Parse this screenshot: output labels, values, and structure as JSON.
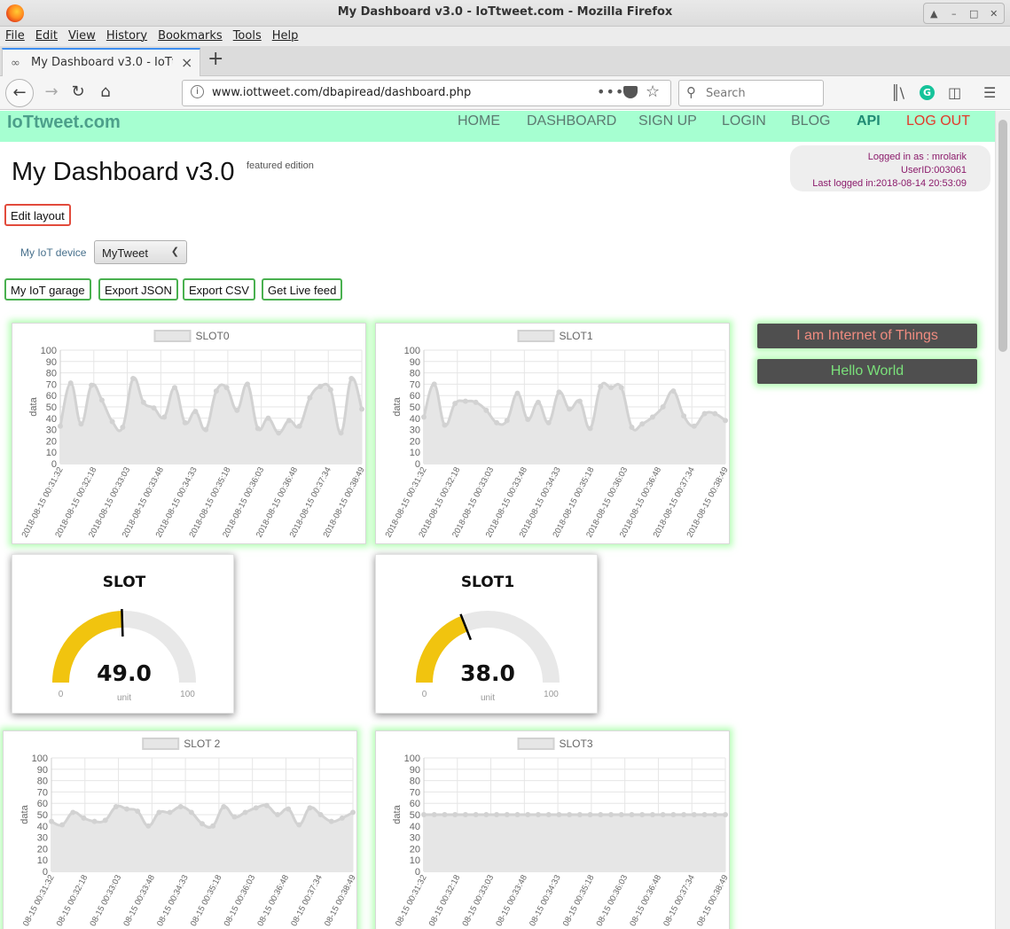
{
  "window": {
    "title": "My Dashboard v3.0 - IoTtweet.com - Mozilla Firefox"
  },
  "menu": [
    "File",
    "Edit",
    "View",
    "History",
    "Bookmarks",
    "Tools",
    "Help"
  ],
  "tab": {
    "label": "My Dashboard v3.0 - IoTtweet.com"
  },
  "url": "www.iottweet.com/dbapiread/dashboard.php",
  "search_placeholder": "Search",
  "site": {
    "brand": "IoTtweet.com",
    "nav": [
      "HOME",
      "DASHBOARD",
      "SIGN UP",
      "LOGIN",
      "BLOG",
      "API",
      "LOG OUT"
    ]
  },
  "page": {
    "title": "My Dashboard v3.0",
    "subtitle": "featured edition"
  },
  "user": {
    "logged_in_as": "Logged in as : mrolarik",
    "user_id": "UserID:003061",
    "last_login": "Last logged in:2018-08-14 20:53:09"
  },
  "buttons": {
    "edit_layout": "Edit layout",
    "garage": "My IoT garage",
    "export_json": "Export JSON",
    "export_csv": "Export CSV",
    "live_feed": "Get Live feed"
  },
  "device": {
    "label": "My IoT device",
    "selected": "MyTweet"
  },
  "messages": [
    {
      "text": "I am Internet of Things",
      "color": "#f08c80"
    },
    {
      "text": "Hello World",
      "color": "#7ae07a"
    }
  ],
  "colors": {
    "series_line": "#d2d2d2",
    "series_fill": "#e6e6e6",
    "gauge_fill": "#f1c40f",
    "gauge_track": "#e8e8e8"
  },
  "chart_data": [
    {
      "type": "line",
      "legend": "SLOT0",
      "ylabel": "data",
      "ylim": [
        0,
        100
      ],
      "yticks": [
        100,
        90,
        80,
        70,
        60,
        50,
        40,
        30,
        20,
        10,
        0
      ],
      "x": [
        "2018-08-15 00:31:32",
        "2018-08-15 00:32:18",
        "2018-08-15 00:33:03",
        "2018-08-15 00:33:48",
        "2018-08-15 00:34:33",
        "2018-08-15 00:35:18",
        "2018-08-15 00:36:03",
        "2018-08-15 00:36:48",
        "2018-08-15 00:37:34",
        "2018-08-15 00:38:49"
      ],
      "values": [
        33,
        71,
        35,
        69,
        56,
        37,
        32,
        75,
        54,
        49,
        41,
        67,
        36,
        46,
        30,
        64,
        67,
        47,
        70,
        31,
        40,
        27,
        38,
        33,
        58,
        68,
        65,
        27,
        75,
        48
      ]
    },
    {
      "type": "line",
      "legend": "SLOT1",
      "ylabel": "data",
      "ylim": [
        0,
        100
      ],
      "yticks": [
        100,
        90,
        80,
        70,
        60,
        50,
        40,
        30,
        20,
        10,
        0
      ],
      "x": [
        "2018-08-15 00:31:32",
        "2018-08-15 00:32:18",
        "2018-08-15 00:33:03",
        "2018-08-15 00:33:48",
        "2018-08-15 00:34:33",
        "2018-08-15 00:35:18",
        "2018-08-15 00:36:03",
        "2018-08-15 00:36:48",
        "2018-08-15 00:37:34",
        "2018-08-15 00:38:49"
      ],
      "values": [
        41,
        70,
        34,
        53,
        55,
        54,
        47,
        36,
        38,
        62,
        39,
        54,
        36,
        63,
        48,
        55,
        31,
        68,
        67,
        67,
        32,
        35,
        41,
        50,
        64,
        42,
        33,
        44,
        44,
        38
      ]
    },
    {
      "type": "gauge",
      "title": "SLOT",
      "value": 49.0,
      "value_label": "49.0",
      "min": 0,
      "max": 100,
      "min_label": "0",
      "max_label": "100",
      "unit": "unit"
    },
    {
      "type": "gauge",
      "title": "SLOT1",
      "value": 38.0,
      "value_label": "38.0",
      "min": 0,
      "max": 100,
      "min_label": "0",
      "max_label": "100",
      "unit": "unit"
    },
    {
      "type": "line",
      "legend": "SLOT 2",
      "ylabel": "data",
      "ylim": [
        0,
        100
      ],
      "yticks": [
        100,
        90,
        80,
        70,
        60,
        50,
        40,
        30,
        20,
        10,
        0
      ],
      "x": [
        "08-15 00:31:32",
        "08-15 00:32:18",
        "08-15 00:33:03",
        "08-15 00:33:48",
        "08-15 00:34:33",
        "08-15 00:35:18",
        "08-15 00:36:03",
        "08-15 00:36:48",
        "08-15 00:37:34",
        "08-15 00:38:49"
      ],
      "values": [
        44,
        41,
        52,
        47,
        44,
        45,
        57,
        55,
        53,
        40,
        52,
        52,
        57,
        52,
        42,
        40,
        57,
        48,
        52,
        56,
        58,
        50,
        55,
        41,
        56,
        50,
        44,
        47,
        52
      ]
    },
    {
      "type": "line",
      "legend": "SLOT3",
      "ylabel": "data",
      "ylim": [
        0,
        100
      ],
      "yticks": [
        100,
        90,
        80,
        70,
        60,
        50,
        40,
        30,
        20,
        10,
        0
      ],
      "x": [
        "08-15 00:31:32",
        "08-15 00:32:18",
        "08-15 00:33:03",
        "08-15 00:33:48",
        "08-15 00:34:33",
        "08-15 00:35:18",
        "08-15 00:36:03",
        "08-15 00:36:48",
        "08-15 00:37:34",
        "08-15 00:38:49"
      ],
      "values": [
        50,
        50,
        50,
        50,
        50,
        50,
        50,
        50,
        50,
        50,
        50,
        50,
        50,
        50,
        50,
        50,
        50,
        50,
        50,
        50,
        50,
        50,
        50,
        50,
        50,
        50,
        50,
        50,
        50,
        50
      ]
    }
  ]
}
